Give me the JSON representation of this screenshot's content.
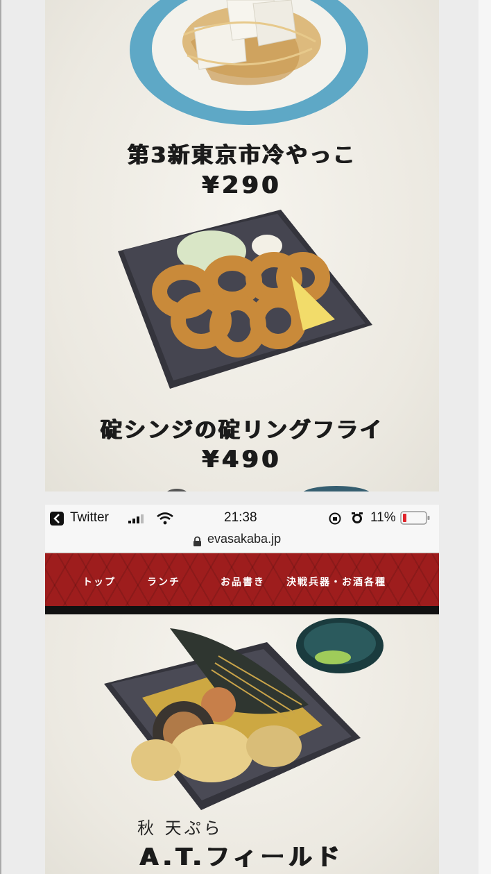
{
  "top_screenshot": {
    "items": [
      {
        "title": "第3新東京市冷やっこ",
        "price": "¥290"
      },
      {
        "title": "碇シンジの碇リングフライ",
        "price": "¥490"
      }
    ]
  },
  "status_bar": {
    "back_app": "Twitter",
    "time": "21:38",
    "battery": "11%"
  },
  "browser": {
    "url": "evasakaba.jp"
  },
  "nav": {
    "items": [
      "トップ",
      "ランチ",
      "お品書き",
      "決戦兵器・お酒各種"
    ]
  },
  "featured": {
    "subtitle": "秋 天ぷら",
    "title": "A.T.フィールド"
  },
  "colors": {
    "nav_red": "#9e1d1d",
    "battery_low": "#e0242b"
  }
}
